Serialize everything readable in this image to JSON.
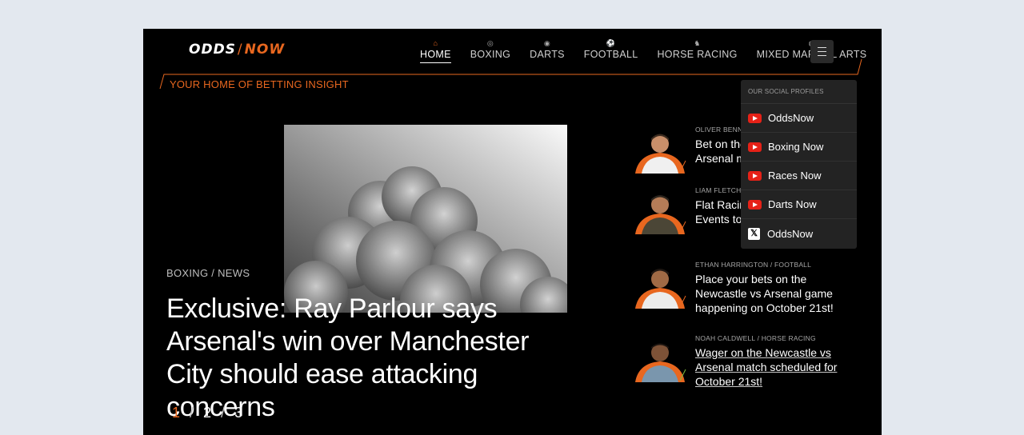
{
  "brand": {
    "word1": "ODDS",
    "word2": "NOW"
  },
  "tagline": "YOUR HOME OF BETTING INSIGHT",
  "nav": [
    {
      "label": "HOME",
      "icon": "home-icon",
      "glyph": "⌂"
    },
    {
      "label": "BOXING",
      "icon": "boxing-glove-icon",
      "glyph": "◎"
    },
    {
      "label": "DARTS",
      "icon": "dartboard-icon",
      "glyph": "◉"
    },
    {
      "label": "FOOTBALL",
      "icon": "football-icon",
      "glyph": "⚽"
    },
    {
      "label": "HORSE RACING",
      "icon": "horse-icon",
      "glyph": "♞"
    },
    {
      "label": "MIXED MARTIAL ARTS",
      "icon": "mma-glove-icon",
      "glyph": "◍"
    }
  ],
  "hero": {
    "meta": "BOXING / NEWS",
    "title": "Exclusive: Ray Parlour says Arsenal's win over Manchester City should ease attacking concerns",
    "pager": {
      "current": "1",
      "p2": "2",
      "p3": "3",
      "sep": "/"
    }
  },
  "articles": [
    {
      "meta": "OLIVER BENNETT",
      "title": "Bet on the Newcastle vs Arsenal match on October 21st!",
      "link": false
    },
    {
      "meta": "LIAM FLETCHER",
      "title": "Flat Racing Classics and Events to watch in 2025",
      "link": false
    },
    {
      "meta": "ETHAN HARRINGTON / FOOTBALL",
      "title": "Place your bets on the Newcastle vs Arsenal game happening on October 21st!",
      "link": false
    },
    {
      "meta": "NOAH CALDWELL / HORSE RACING",
      "title": "Wager on the Newcastle vs Arsenal match scheduled for October 21st!",
      "link": true
    }
  ],
  "social": {
    "heading": "OUR SOCIAL PROFILES",
    "items": [
      {
        "label": "OddsNow",
        "icon": "youtube-icon"
      },
      {
        "label": "Boxing Now",
        "icon": "youtube-icon"
      },
      {
        "label": "Races Now",
        "icon": "youtube-icon"
      },
      {
        "label": "Darts Now",
        "icon": "youtube-icon"
      },
      {
        "label": "OddsNow",
        "icon": "x-icon"
      }
    ]
  },
  "colors": {
    "accent": "#e8671f",
    "background": "#000000",
    "page": "#e3e8ef",
    "dropdown": "#232323",
    "youtube": "#e62117"
  }
}
